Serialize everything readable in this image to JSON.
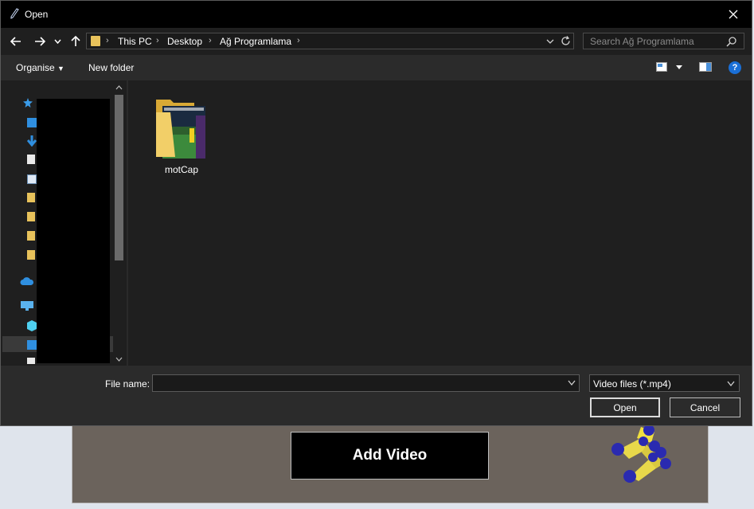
{
  "dialog": {
    "title": "Open",
    "breadcrumb": [
      "This PC",
      "Desktop",
      "Ağ Programlama"
    ],
    "search_placeholder": "Search Ağ Programlama",
    "toolbar": {
      "organise_label": "Organise",
      "new_folder_label": "New folder",
      "help_label": "?"
    },
    "items": [
      {
        "name": "motCap",
        "type": "folder"
      }
    ],
    "file_name_label": "File name:",
    "file_name_value": "",
    "file_type_value": "Video files (*.mp4)",
    "open_label": "Open",
    "cancel_label": "Cancel"
  },
  "background_app": {
    "add_video_label": "Add Video"
  },
  "colors": {
    "titlebar": "#000000",
    "dialog_bg": "#2b2b2b",
    "pane_bg": "#1f1f1f",
    "folder_yellow": "#e8c25b",
    "accent_blue": "#1a6fd6",
    "bg_app": "#6b635c"
  },
  "icons": [
    "pen-icon",
    "close-icon",
    "back-arrow-icon",
    "forward-arrow-icon",
    "recent-dropdown-icon",
    "up-arrow-icon",
    "folder-icon",
    "chevron-down-icon",
    "refresh-icon",
    "search-icon",
    "view-options-icon",
    "preview-pane-icon",
    "help-icon"
  ]
}
